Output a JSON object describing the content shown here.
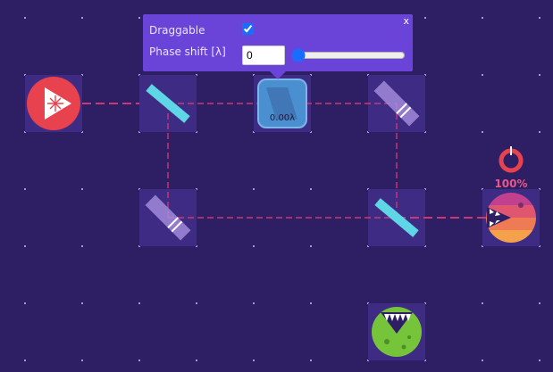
{
  "popup": {
    "draggable_label": "Draggable",
    "draggable_checked": true,
    "phase_label": "Phase shift [λ]",
    "phase_value": "0",
    "phase_slider_min": "0",
    "phase_slider_max": "1",
    "phase_slider_value": "0",
    "close_label": "x"
  },
  "board": {
    "phase_element_label": "0.00λ",
    "detector_percent": "100%",
    "detector_fraction": 1.0
  },
  "colors": {
    "background": "#2e1f64",
    "beam": "#c83a72",
    "popup_bg": "#6a44d8",
    "laser": "#e8424f",
    "mirror": "#5fd6e6",
    "rock_detector": "#76c43a",
    "pink_detector": "#e0506a"
  },
  "icons": {
    "laser": "laser-icon",
    "beam_splitter": "beam-splitter-icon",
    "mirror": "mirror-icon",
    "phase": "phase-shifter-icon",
    "detector": "detector-monster-icon",
    "rock": "rock-monster-icon"
  }
}
